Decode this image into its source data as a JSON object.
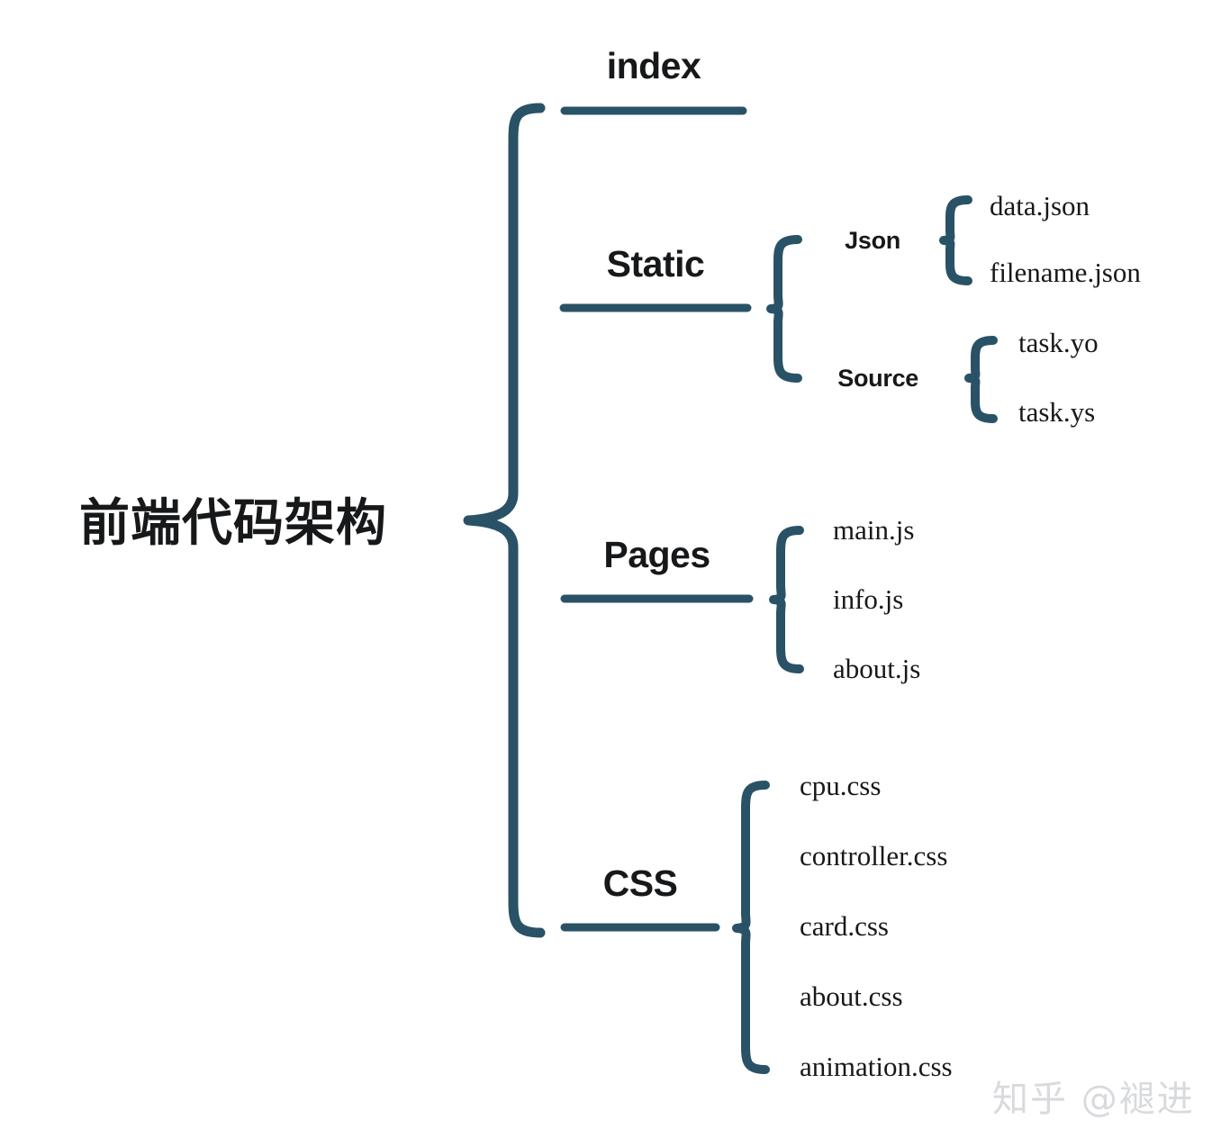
{
  "theme": {
    "background": "#ffffff",
    "line_color": "#2a5267",
    "text_color": "#16181a",
    "watermark_color": "#d8dadd"
  },
  "diagram": {
    "type": "bracket-tree",
    "root": "前端代码架构",
    "branches": [
      {
        "label": "index",
        "children": []
      },
      {
        "label": "Static",
        "children": [
          {
            "label": "Json",
            "children": [
              "data.json",
              "filename.json"
            ]
          },
          {
            "label": "Source",
            "children": [
              "task.yo",
              "task.ys"
            ]
          }
        ]
      },
      {
        "label": "Pages",
        "children": [
          "main.js",
          "info.js",
          "about.js"
        ]
      },
      {
        "label": "CSS",
        "children": [
          "cpu.css",
          "controller.css",
          "card.css",
          "about.css",
          "animation.css"
        ]
      }
    ]
  },
  "labels": {
    "root": "前端代码架构",
    "index": "index",
    "static": "Static",
    "pages": "Pages",
    "css": "CSS",
    "json": "Json",
    "source": "Source",
    "data_json": "data.json",
    "filename_json": "filename.json",
    "task_yo": "task.yo",
    "task_ys": "task.ys",
    "main_js": "main.js",
    "info_js": "info.js",
    "about_js": "about.js",
    "cpu_css": "cpu.css",
    "controller_css": "controller.css",
    "card_css": "card.css",
    "about_css": "about.css",
    "animation_css": "animation.css"
  },
  "watermark": {
    "text": "知乎 @褪进"
  }
}
